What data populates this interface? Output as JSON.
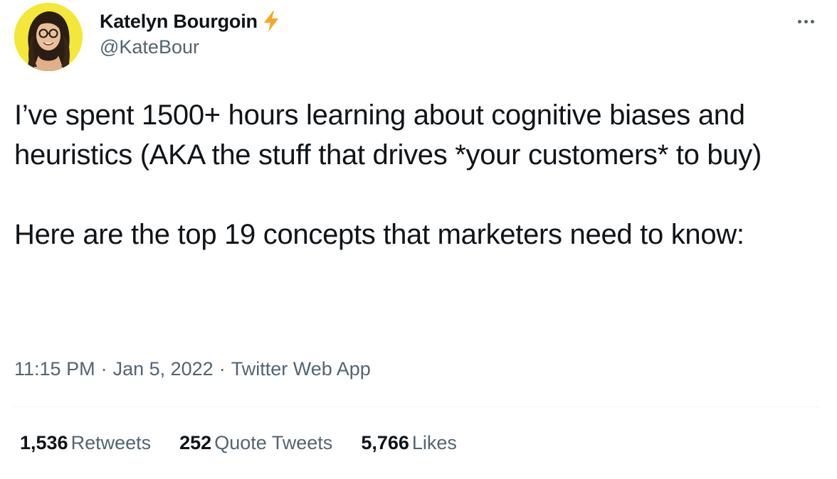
{
  "author": {
    "display_name": "Katelyn Bourgoin",
    "handle": "@KateBour",
    "badge_icon": "lightning-bolt-icon",
    "avatar_bg": "#f3e83a"
  },
  "tweet": {
    "paragraphs": [
      "I’ve spent 1500+ hours learning about cognitive biases and heuristics (AKA the stuff that drives *your customers* to buy)",
      "Here are the top 19 concepts that marketers need to know:"
    ],
    "time": "11:15 PM",
    "date": "Jan 5, 2022",
    "source": "Twitter Web App",
    "separator": "·"
  },
  "stats": {
    "retweets_count": "1,536",
    "retweets_label": "Retweets",
    "quotes_count": "252",
    "quotes_label": "Quote Tweets",
    "likes_count": "5,766",
    "likes_label": "Likes"
  },
  "colors": {
    "text_primary": "#0f1419",
    "text_secondary": "#536471",
    "divider": "#eff3f4",
    "bolt": "#f5a623"
  }
}
